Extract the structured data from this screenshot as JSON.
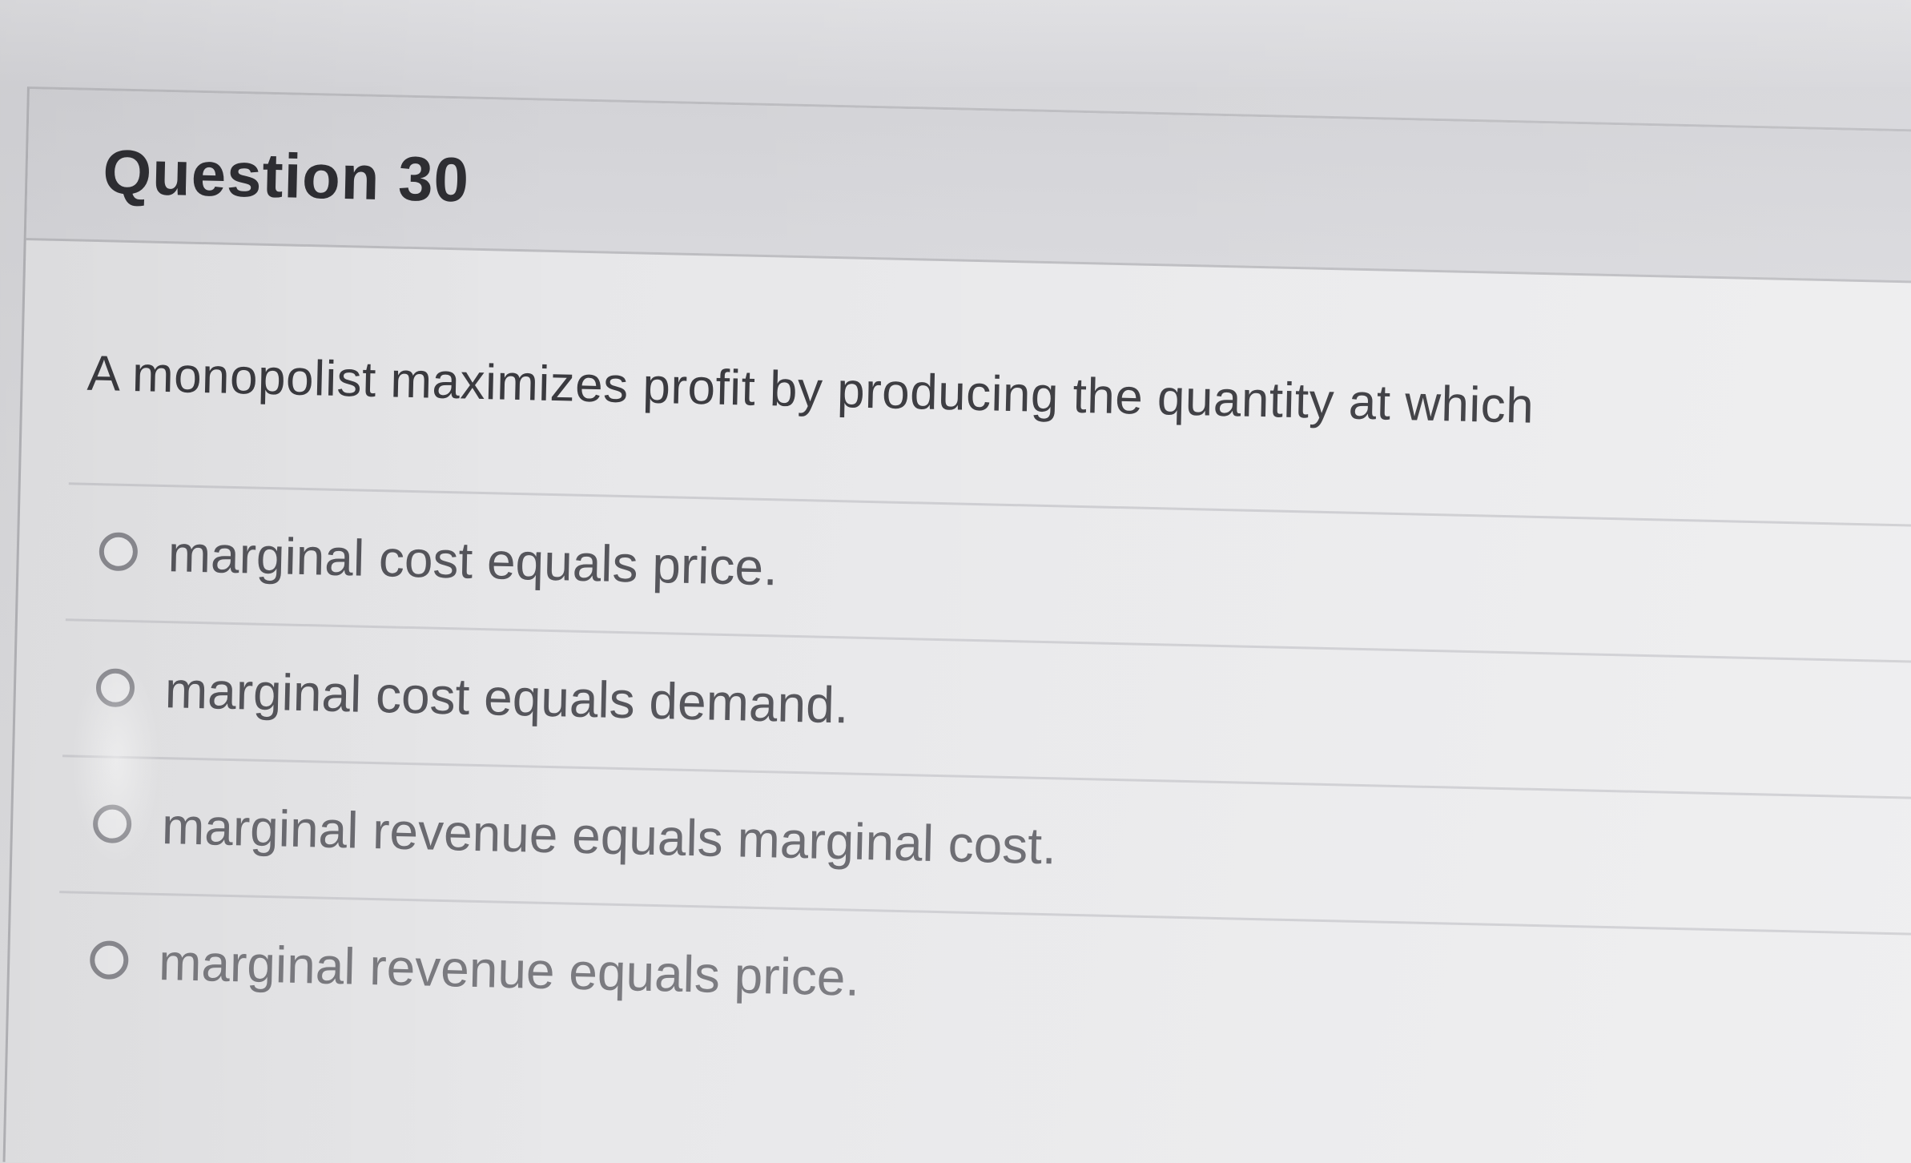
{
  "question": {
    "title": "Question 30",
    "prompt": "A monopolist maximizes profit by producing the quantity at which",
    "options": [
      {
        "label": "marginal cost equals price."
      },
      {
        "label": "marginal cost equals demand."
      },
      {
        "label": "marginal revenue equals marginal cost."
      },
      {
        "label": "marginal revenue equals price."
      }
    ]
  },
  "colors": {
    "background": "#d9d9dc",
    "card": "#e9e9eb",
    "header": "#d5d5d9",
    "title_text": "#2e2e33",
    "option_text": "#55555b"
  }
}
